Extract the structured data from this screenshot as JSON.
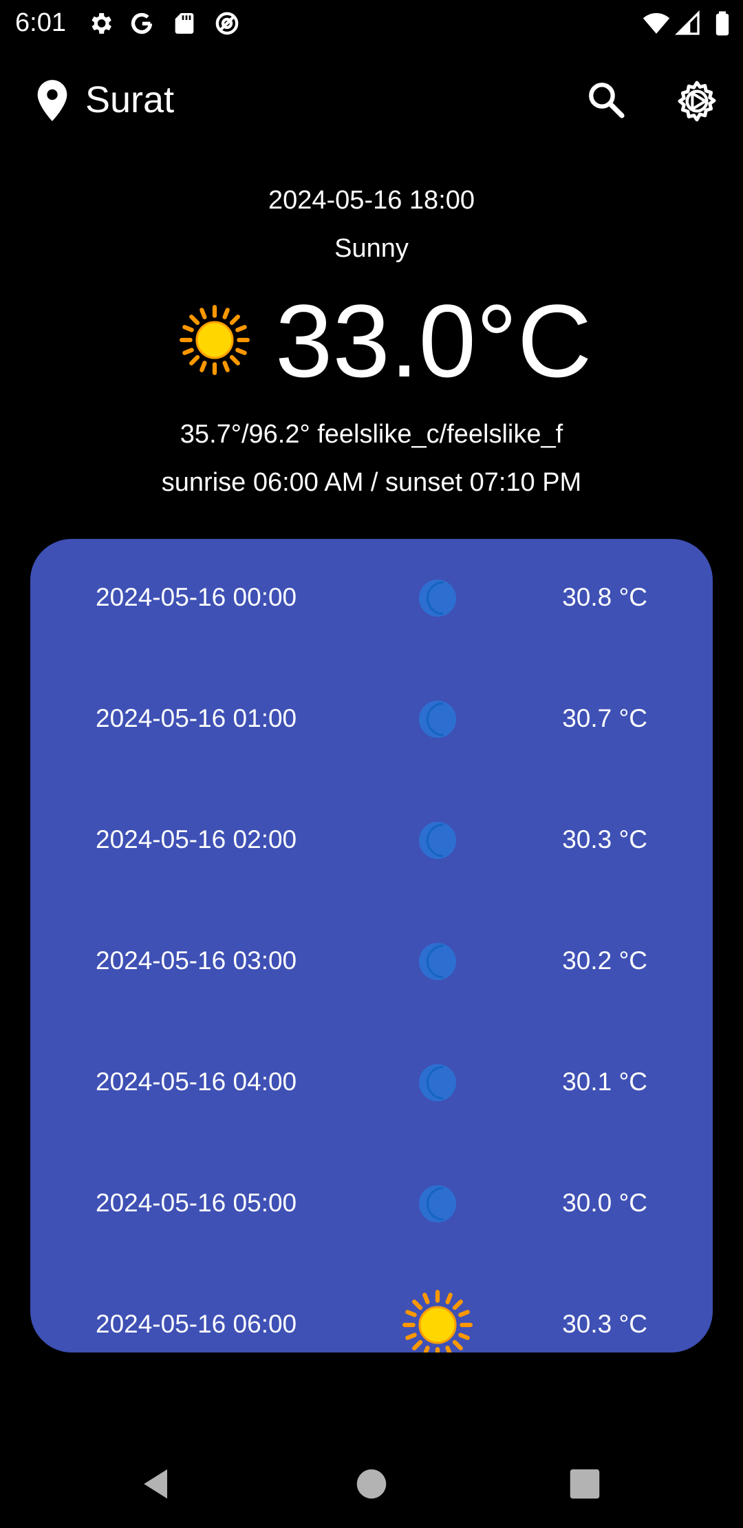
{
  "status_bar": {
    "time": "6:01",
    "left_icons": [
      "gear-icon",
      "google-icon",
      "sd-card-icon",
      "at-sign-icon"
    ],
    "right_icons": [
      "wifi-icon",
      "signal-icon",
      "battery-icon"
    ]
  },
  "app_bar": {
    "location_icon": "location-pin-icon",
    "city": "Surat",
    "search_icon": "search-icon",
    "settings_icon": "settings-icon"
  },
  "current": {
    "datetime": "2024-05-16 18:00",
    "condition": "Sunny",
    "icon": "sun-icon",
    "temperature": "33.0°C",
    "feelslike": "35.7°/96.2° feelslike_c/feelslike_f",
    "sun_times": "sunrise 06:00 AM / sunset 07:10 PM"
  },
  "hourly": [
    {
      "time": "2024-05-16 00:00",
      "icon": "moon-icon",
      "temp": "30.8 °C"
    },
    {
      "time": "2024-05-16 01:00",
      "icon": "moon-icon",
      "temp": "30.7 °C"
    },
    {
      "time": "2024-05-16 02:00",
      "icon": "moon-icon",
      "temp": "30.3 °C"
    },
    {
      "time": "2024-05-16 03:00",
      "icon": "moon-icon",
      "temp": "30.2 °C"
    },
    {
      "time": "2024-05-16 04:00",
      "icon": "moon-icon",
      "temp": "30.1 °C"
    },
    {
      "time": "2024-05-16 05:00",
      "icon": "moon-icon",
      "temp": "30.0 °C"
    },
    {
      "time": "2024-05-16 06:00",
      "icon": "sun-icon",
      "temp": "30.3 °C"
    }
  ],
  "nav_bar": {
    "back": "back-icon",
    "home": "home-icon",
    "recents": "recents-icon"
  },
  "colors": {
    "background": "#000000",
    "card": "#3f51b5",
    "text": "#ffffff",
    "sun": "#ffd600",
    "sun_rays": "#ff9800",
    "moon": "#ffffff",
    "moon_glow": "#1e88e5",
    "nav_icons": "#b3b3b3"
  }
}
